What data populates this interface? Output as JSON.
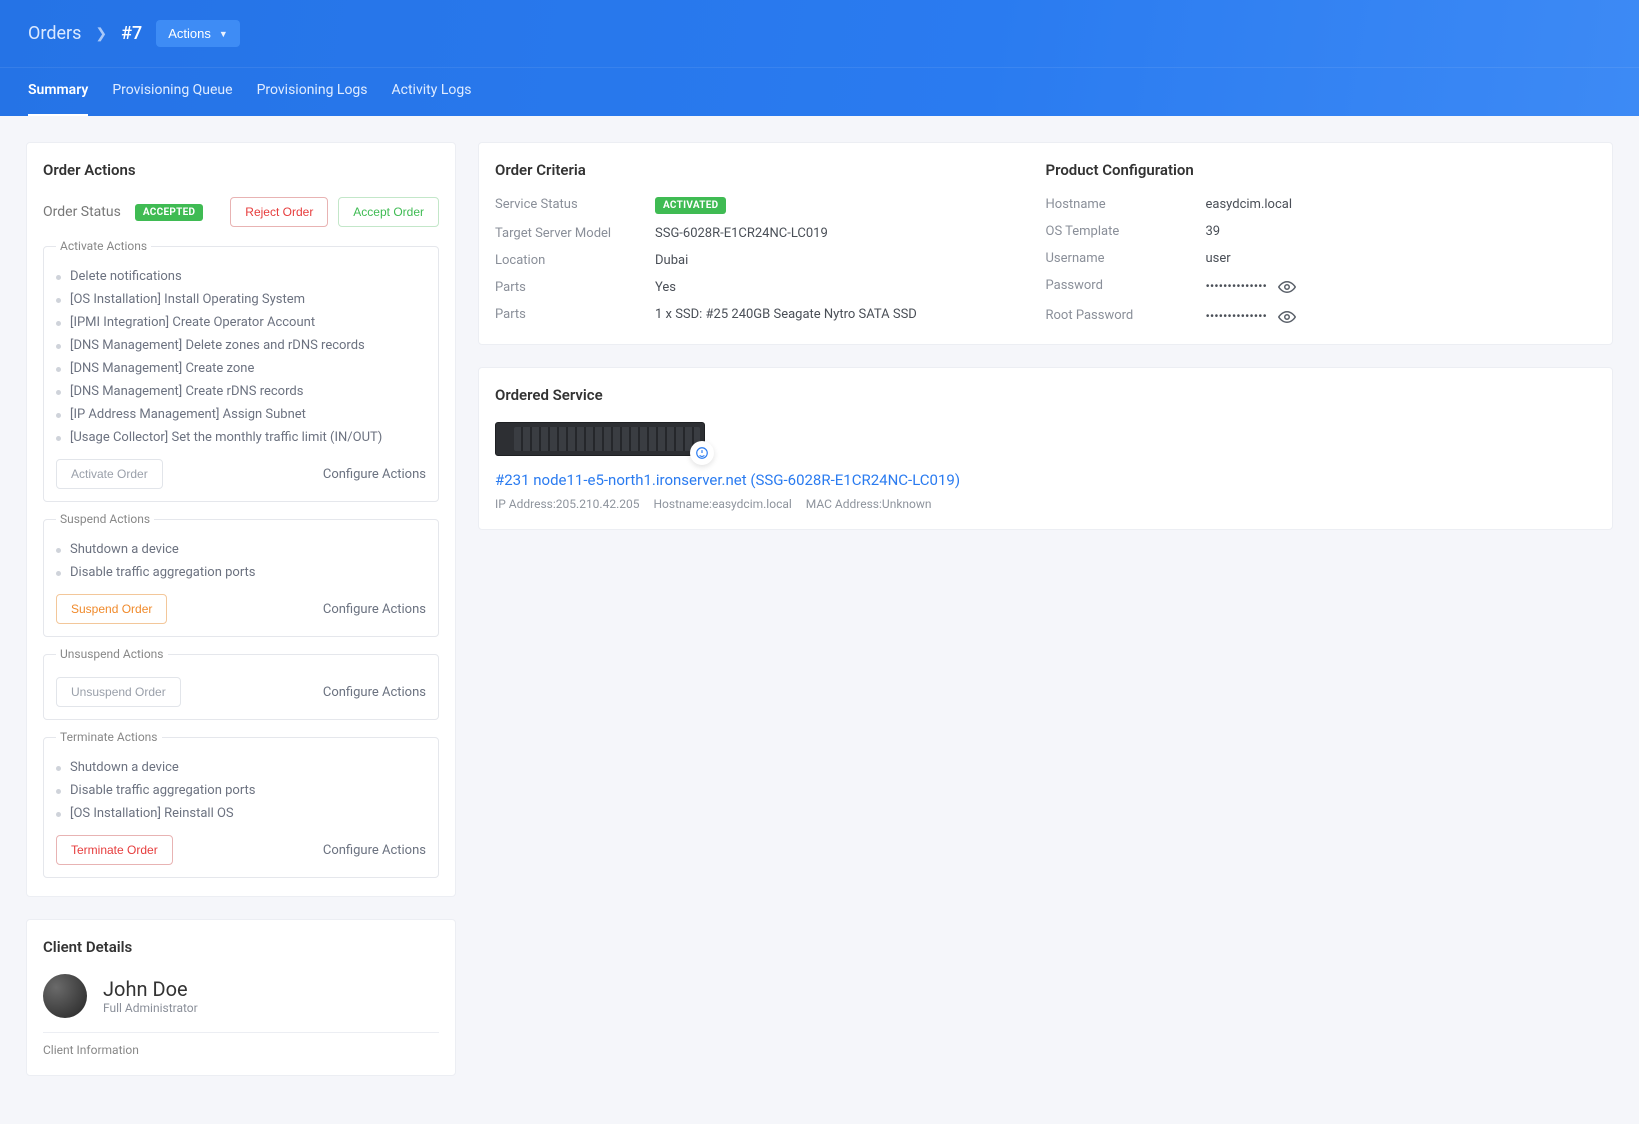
{
  "breadcrumb": {
    "root": "Orders",
    "current": "#7"
  },
  "actions_button": "Actions",
  "tabs": {
    "summary": "Summary",
    "prov_queue": "Provisioning Queue",
    "prov_logs": "Provisioning Logs",
    "activity_logs": "Activity Logs"
  },
  "order_actions": {
    "title": "Order Actions",
    "status_label": "Order Status",
    "status_badge": "ACCEPTED",
    "reject": "Reject Order",
    "accept": "Accept Order",
    "activate": {
      "legend": "Activate Actions",
      "items": [
        "Delete notifications",
        "[OS Installation] Install Operating System",
        "[IPMI Integration] Create Operator Account",
        "[DNS Management] Delete zones and rDNS records",
        "[DNS Management] Create zone",
        "[DNS Management] Create rDNS records",
        "[IP Address Management] Assign Subnet",
        "[Usage Collector] Set the monthly traffic limit (IN/OUT)"
      ],
      "primary_btn": "Activate Order",
      "configure": "Configure Actions"
    },
    "suspend": {
      "legend": "Suspend Actions",
      "items": [
        "Shutdown a device",
        "Disable traffic aggregation ports"
      ],
      "primary_btn": "Suspend Order",
      "configure": "Configure Actions"
    },
    "unsuspend": {
      "legend": "Unsuspend Actions",
      "primary_btn": "Unsuspend Order",
      "configure": "Configure Actions"
    },
    "terminate": {
      "legend": "Terminate Actions",
      "items": [
        "Shutdown a device",
        "Disable traffic aggregation ports",
        "[OS Installation] Reinstall OS"
      ],
      "primary_btn": "Terminate Order",
      "configure": "Configure Actions"
    }
  },
  "order_criteria": {
    "title": "Order Criteria",
    "service_status_label": "Service Status",
    "service_status_badge": "ACTIVATED",
    "rows": {
      "target_model_k": "Target Server Model",
      "target_model_v": "SSG-6028R-E1CR24NC-LC019",
      "location_k": "Location",
      "location_v": "Dubai",
      "parts_k": "Parts",
      "parts_v": "Yes",
      "parts2_k": "Parts",
      "parts2_v": "1 x SSD: #25 240GB Seagate Nytro SATA SSD"
    }
  },
  "product_config": {
    "title": "Product Configuration",
    "rows": {
      "hostname_k": "Hostname",
      "hostname_v": "easydcim.local",
      "os_k": "OS Template",
      "os_v": "39",
      "user_k": "Username",
      "user_v": "user",
      "pw_k": "Password",
      "pw_v": "••••••••••••••",
      "rootpw_k": "Root Password",
      "rootpw_v": "••••••••••••••"
    }
  },
  "ordered_service": {
    "title": "Ordered Service",
    "link": "#231 node11-e5-north1.ironserver.net (SSG-6028R-E1CR24NC-LC019)",
    "ip_label": "IP Address:",
    "ip": "205.210.42.205",
    "hostname_label": "Hostname:",
    "hostname": "easydcim.local",
    "mac_label": "MAC Address:",
    "mac": "Unknown"
  },
  "client_details": {
    "title": "Client Details",
    "name": "John Doe",
    "role": "Full Administrator",
    "info_legend": "Client Information"
  }
}
